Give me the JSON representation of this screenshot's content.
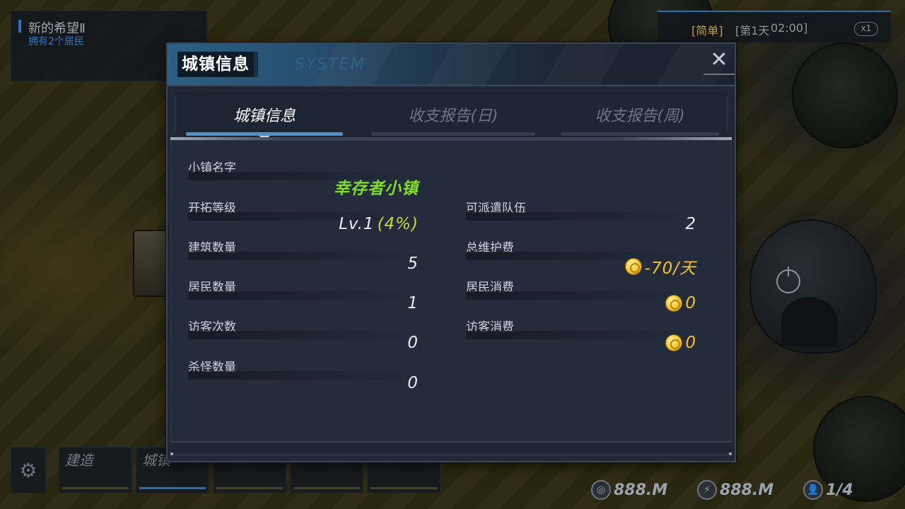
{
  "hud": {
    "town_name": "新的希望Ⅱ",
    "town_sub": "拥有2个居民",
    "difficulty": "[简单]",
    "day": "[第1天",
    "clock": "02:00]",
    "speed": "x1"
  },
  "bottom_bar": {
    "slot1_label": "建造",
    "slot2_label": "城镇"
  },
  "resources": {
    "gold": "888.M",
    "energy": "888.M",
    "population": "1/4"
  },
  "modal": {
    "title": "城镇信息",
    "subtitle": "SYSTEM",
    "close_glyph": "✕",
    "tabs": [
      {
        "label": "城镇信息",
        "active": true
      },
      {
        "label": "收支报告(日)",
        "active": false
      },
      {
        "label": "收支报告(周)",
        "active": false
      }
    ],
    "left_stats": {
      "town_name_label": "小镇名字",
      "town_name_value": "幸存者小镇",
      "level_label": "开拓等级",
      "level_value": "Lv.1",
      "level_pct": "(4%)",
      "buildings_label": "建筑数量",
      "buildings_value": "5",
      "residents_label": "居民数量",
      "residents_value": "1",
      "visitors_label": "访客次数",
      "visitors_value": "0",
      "kills_label": "杀怪数量",
      "kills_value": "0"
    },
    "right_stats": {
      "teams_label": "可派遣队伍",
      "teams_value": "2",
      "upkeep_label": "总维护费",
      "upkeep_value": "-70/天",
      "resident_cost_label": "居民消费",
      "resident_cost_value": "0",
      "visitor_cost_label": "访客消费",
      "visitor_cost_value": "0"
    }
  },
  "colors": {
    "accent_blue": "#4f8fc5",
    "value_green": "#7ddc2a",
    "gold": "#f1c22c",
    "panel_bg": "#242c3b"
  }
}
